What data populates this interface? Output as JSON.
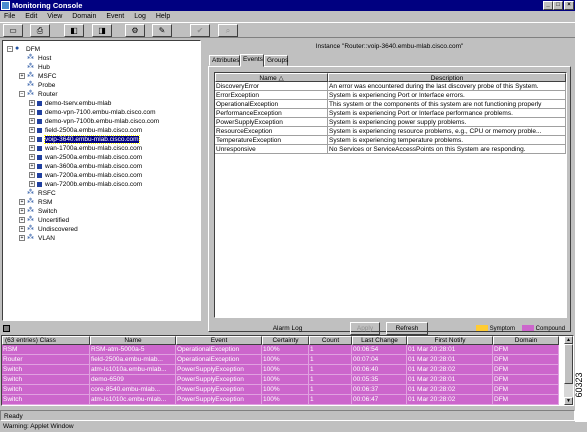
{
  "window": {
    "title": "Monitoring Console"
  },
  "menu": [
    "File",
    "Edit",
    "View",
    "Domain",
    "Event",
    "Log",
    "Help"
  ],
  "tree": {
    "root": "DFM",
    "items": [
      {
        "label": "Host",
        "indent": 1,
        "expander": false
      },
      {
        "label": "Hub",
        "indent": 1,
        "expander": false
      },
      {
        "label": "MSFC",
        "indent": 1,
        "expander": true
      },
      {
        "label": "Probe",
        "indent": 1,
        "expander": false
      },
      {
        "label": "Router",
        "indent": 1,
        "expander": true
      },
      {
        "label": "demo-tserv.embu-mlab",
        "indent": 2,
        "expander": true
      },
      {
        "label": "demo-vpn-7100.embu-mlab.cisco.com",
        "indent": 2,
        "expander": true
      },
      {
        "label": "demo-vpn-7100b.embu-mlab.cisco.com",
        "indent": 2,
        "expander": true
      },
      {
        "label": "field-2500a.embu-mlab.cisco.com",
        "indent": 2,
        "expander": true
      },
      {
        "label": "voip-3640.embu-mlab.cisco.com",
        "indent": 2,
        "expander": true,
        "selected": true
      },
      {
        "label": "wan-1700a.embu-mlab.cisco.com",
        "indent": 2,
        "expander": true
      },
      {
        "label": "wan-2500a.embu-mlab.cisco.com",
        "indent": 2,
        "expander": true
      },
      {
        "label": "wan-3600a.embu-mlab.cisco.com",
        "indent": 2,
        "expander": true
      },
      {
        "label": "wan-7200a.embu-mlab.cisco.com",
        "indent": 2,
        "expander": true
      },
      {
        "label": "wan-7200b.embu-mlab.cisco.com",
        "indent": 2,
        "expander": true
      },
      {
        "label": "RSFC",
        "indent": 1,
        "expander": false
      },
      {
        "label": "RSM",
        "indent": 1,
        "expander": true
      },
      {
        "label": "Switch",
        "indent": 1,
        "expander": true
      },
      {
        "label": "Uncertified",
        "indent": 1,
        "expander": true
      },
      {
        "label": "Undiscovered",
        "indent": 1,
        "expander": true
      },
      {
        "label": "VLAN",
        "indent": 1,
        "expander": true
      }
    ]
  },
  "instance_title": "Instance \"Router::voip-3640.embu-mlab.cisco.com\"",
  "tabs": [
    "Attributes",
    "Events",
    "Groups"
  ],
  "events": {
    "headers": {
      "name": "Name",
      "description": "Description"
    },
    "rows": [
      {
        "name": "DiscoveryError",
        "description": "An error was encountered during the last discovery probe of this System."
      },
      {
        "name": "ErrorException",
        "description": "System is experiencing Port or Interface errors."
      },
      {
        "name": "OperationalException",
        "description": "This system or the components of this system are not functioning properly"
      },
      {
        "name": "PerformanceException",
        "description": "System is experiencing Port or Interface performance problems."
      },
      {
        "name": "PowerSupplyException",
        "description": "System is experiencing power supply problems."
      },
      {
        "name": "ResourceException",
        "description": "System is experiencing resource problems, e.g., CPU or memory proble..."
      },
      {
        "name": "TemperatureException",
        "description": "System is experiencing temperature problems."
      },
      {
        "name": "Unresponsive",
        "description": "No Services or ServiceAccessPoints on this System are responding."
      }
    ]
  },
  "buttons": {
    "apply": "Apply",
    "refresh": "Refresh"
  },
  "alarm_log": {
    "title": "Alarm Log",
    "legend": {
      "symptom": "Symptom",
      "compound": "Compound"
    },
    "headers": [
      "(63 entries) Class",
      "Name",
      "Event",
      "Certainty",
      "Count",
      "Last Change",
      "First Notify",
      "Domain"
    ],
    "rows": [
      [
        "RSM",
        "RSM-atm-5000a-5",
        "OperationalException",
        "100%",
        "1",
        "00:06:54",
        "01 Mar 20:28:01",
        "DFM"
      ],
      [
        "Router",
        "field-2500a.embu-mlab...",
        "OperationalException",
        "100%",
        "1",
        "00:07:04",
        "01 Mar 20:28:01",
        "DFM"
      ],
      [
        "Switch",
        "atm-ls1010a.embu-mlab...",
        "PowerSupplyException",
        "100%",
        "1",
        "00:06:40",
        "01 Mar 20:28:02",
        "DFM"
      ],
      [
        "Switch",
        "demo-6509",
        "PowerSupplyException",
        "100%",
        "1",
        "00:05:35",
        "01 Mar 20:28:01",
        "DFM"
      ],
      [
        "Switch",
        "core-8540.embu-mlab...",
        "PowerSupplyException",
        "100%",
        "1",
        "00:06:37",
        "01 Mar 20:28:02",
        "DFM"
      ],
      [
        "Switch",
        "atm-ls1010c.embu-mlab...",
        "PowerSupplyException",
        "100%",
        "1",
        "00:06:47",
        "01 Mar 20:28:02",
        "DFM"
      ]
    ]
  },
  "status": {
    "text": "Ready",
    "warning": "Warning: Applet Window"
  },
  "figure_number": "60323",
  "colors": {
    "title_bar": "#000080",
    "alarm_row": "#cc66cc",
    "symptom": "#ffcc33",
    "compound": "#cc66cc"
  }
}
